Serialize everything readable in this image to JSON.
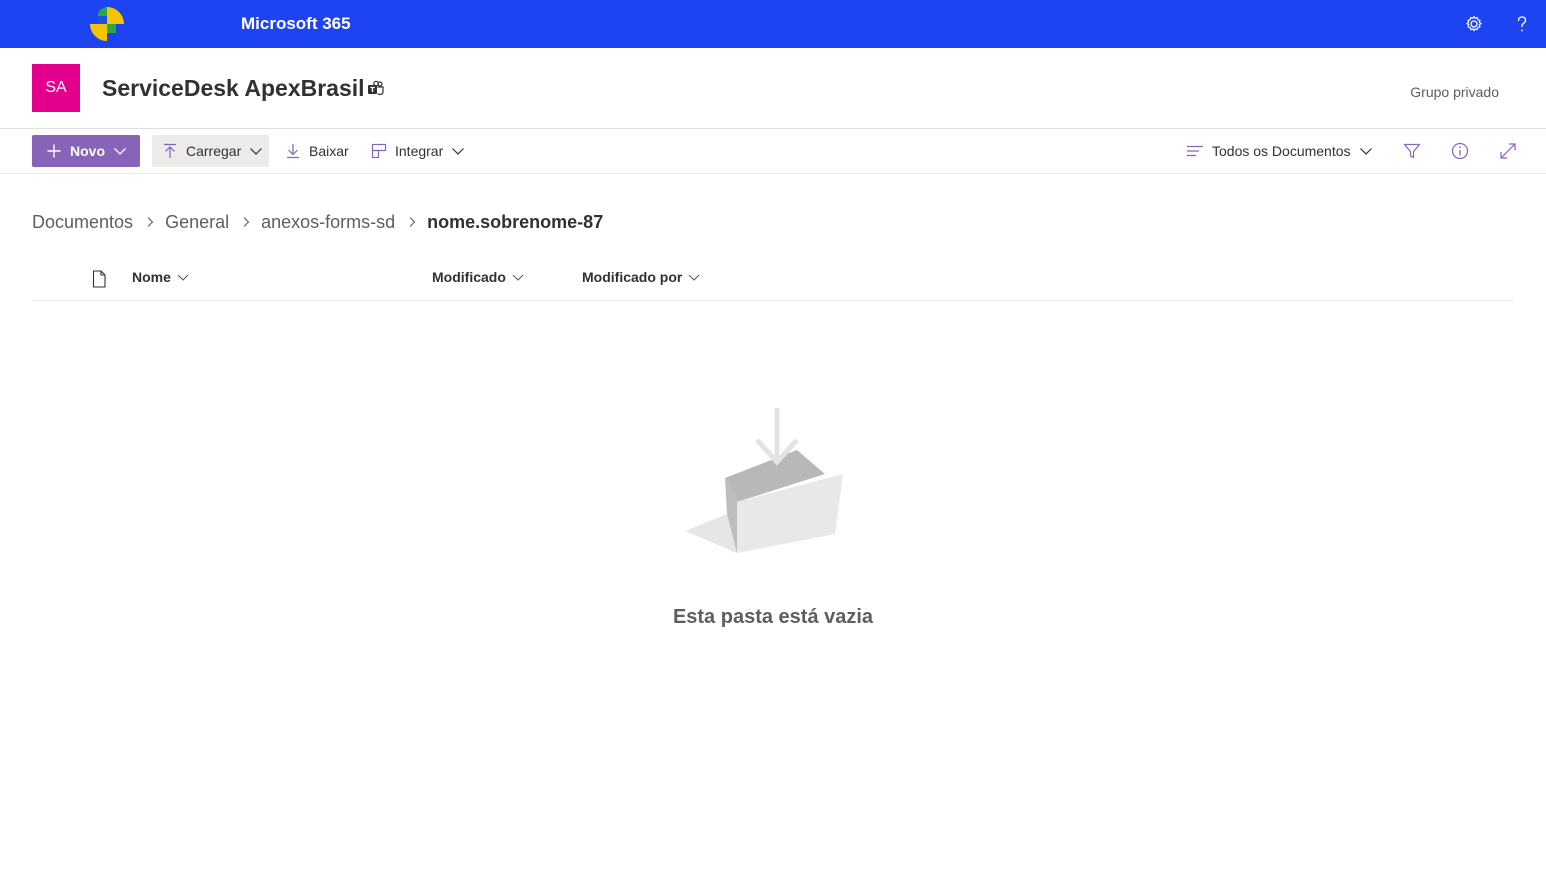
{
  "suite_bar": {
    "app_name": "Microsoft 365",
    "icons": [
      "settings-gear-icon",
      "help-question-icon"
    ],
    "color": "#1d44f0"
  },
  "site": {
    "logo_initials": "SA",
    "logo_color": "#e3008c",
    "title": "ServiceDesk ApexBrasil",
    "group_type": "Grupo privado"
  },
  "commandbar": {
    "novo": "Novo",
    "carregar": "Carregar",
    "baixar": "Baixar",
    "integrar": "Integrar",
    "view": "Todos os Documentos",
    "accent": "#8764b8"
  },
  "breadcrumb": {
    "items": [
      "Documentos",
      "General",
      "anexos-forms-sd"
    ],
    "current": "nome.sobrenome-87"
  },
  "columns": {
    "name": "Nome",
    "modified": "Modificado",
    "modified_by": "Modificado por"
  },
  "empty_state": {
    "message": "Esta pasta está vazia",
    "icon": "empty-folder-illustration"
  }
}
